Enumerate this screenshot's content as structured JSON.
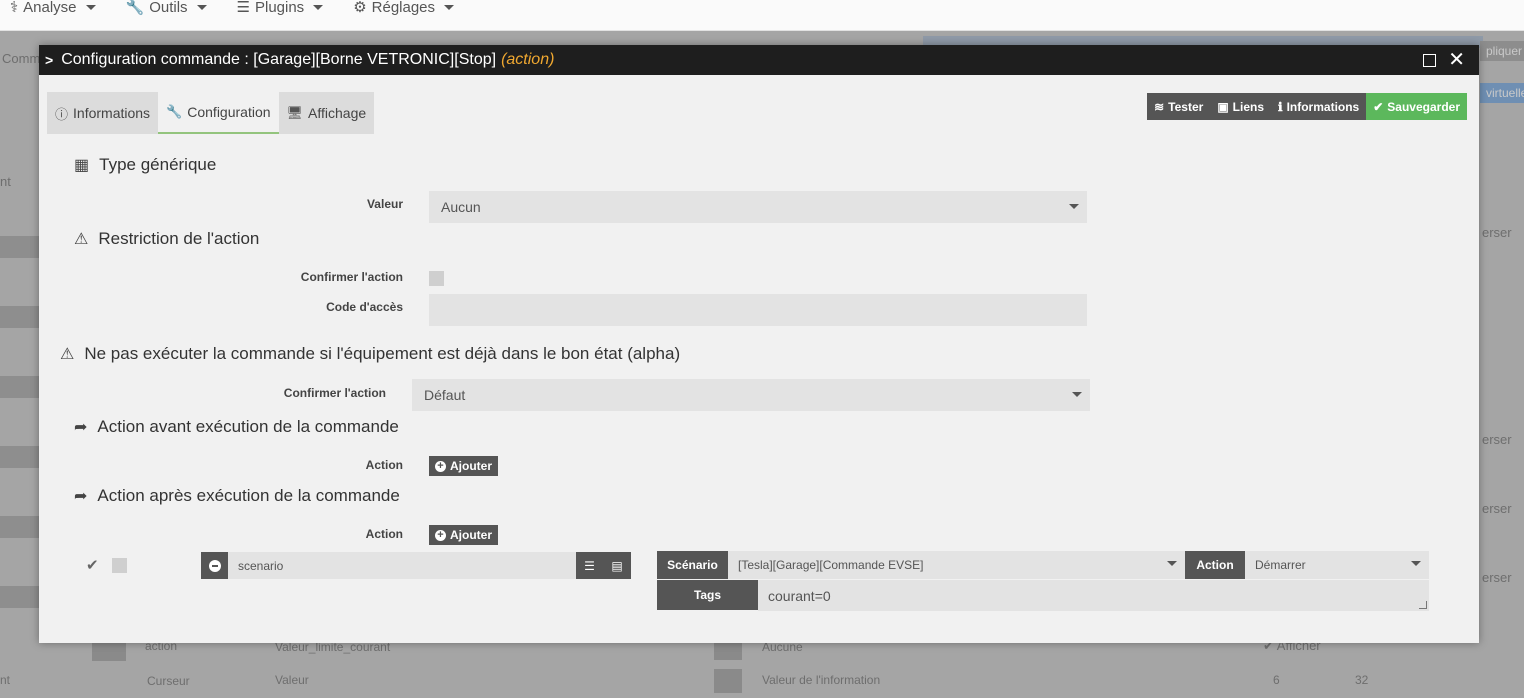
{
  "menubar": {
    "items": [
      {
        "label": "Analyse",
        "icon": "stethoscope-icon"
      },
      {
        "label": "Outils",
        "icon": "wrench-icon"
      },
      {
        "label": "Plugins",
        "icon": "tasks-icon"
      },
      {
        "label": "Réglages",
        "icon": "gear-icon"
      }
    ]
  },
  "background": {
    "left_texts": [
      "Comm",
      "nt",
      "nt"
    ],
    "right_texts": [
      "pliquer",
      "virtuelle",
      "erser",
      "erser",
      "erser",
      "erser"
    ],
    "row1": {
      "col1": "action",
      "col2": "Valeur_limite_courant",
      "col3": "Aucune",
      "col4": "Afficher"
    },
    "row2": {
      "col1": "Curseur",
      "col2": "Valeur",
      "col3": "Valeur de l'information",
      "col4": "6",
      "col5": "32"
    }
  },
  "modal": {
    "title": "Configuration commande : [Garage][Borne VETRONIC][Stop]",
    "title_tag": "(action)",
    "tabs": [
      {
        "label": "Informations",
        "icon": "info-circle-icon"
      },
      {
        "label": "Configuration",
        "icon": "wrench-icon"
      },
      {
        "label": "Affichage",
        "icon": "desktop-icon"
      }
    ],
    "buttons": {
      "tester": "Tester",
      "liens": "Liens",
      "informations": "Informations",
      "sauvegarder": "Sauvegarder"
    },
    "generic_type": {
      "title": "Type générique",
      "value_label": "Valeur",
      "value": "Aucun"
    },
    "restriction": {
      "title": "Restriction de l'action",
      "confirm_label": "Confirmer l'action",
      "code_label": "Code d'accès",
      "code_value": ""
    },
    "no_exec": {
      "title": "Ne pas exécuter la commande si l'équipement est déjà dans le bon état (alpha)",
      "confirm_label": "Confirmer l'action",
      "value": "Défaut"
    },
    "before_action": {
      "title": "Action avant exécution de la commande",
      "action_label": "Action",
      "add_label": "Ajouter"
    },
    "after_action": {
      "title": "Action après exécution de la commande",
      "action_label": "Action",
      "add_label": "Ajouter",
      "row": {
        "command": "scenario",
        "scenario_label": "Scénario",
        "scenario_value": "[Tesla][Garage][Commande EVSE]",
        "action_label": "Action",
        "action_value": "Démarrer",
        "tags_label": "Tags",
        "tags_value": "courant=0"
      }
    }
  }
}
